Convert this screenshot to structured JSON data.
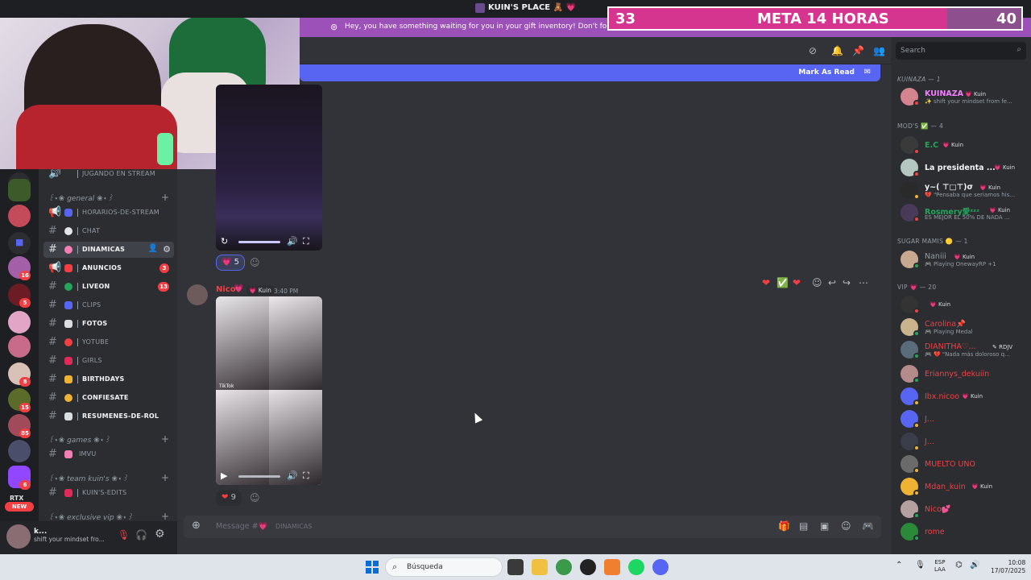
{
  "window": {
    "title": "KUIN'S PLACE 🧸 💗"
  },
  "notice": {
    "text": "Hey, you have something waiting for you in your gift inventory! Don't forget to clai"
  },
  "overlay": {
    "left_value": "33",
    "label": "META 14 HORAS",
    "right_value": "40"
  },
  "server_rail": {
    "badges": [
      "16",
      "5",
      "8",
      "15",
      "85",
      "6"
    ],
    "rtx_label": "RTX",
    "new_label": "NEW"
  },
  "channels": {
    "top_partial": "JUGANDO EN STREAM",
    "categories": [
      {
        "label": "꒰⋆❀ general ❀⋆꒱"
      },
      {
        "label": "꒰⋆❀ games ❀⋆꒱"
      },
      {
        "label": "꒰⋆❀ team kuin's ❀⋆꒱"
      },
      {
        "label": "꒰⋆❀ exclusive vip ❀⋆꒱"
      }
    ],
    "items": [
      {
        "name": "horarios-de-stream"
      },
      {
        "name": "chat"
      },
      {
        "name": "dinamicas"
      },
      {
        "name": "anuncios",
        "badge": "3"
      },
      {
        "name": "liveon",
        "badge": "13"
      },
      {
        "name": "clips"
      },
      {
        "name": "fotos"
      },
      {
        "name": "yotube"
      },
      {
        "name": "girls"
      },
      {
        "name": "birthdays"
      },
      {
        "name": "confiesate"
      },
      {
        "name": "resumenes-de-rol"
      },
      {
        "name": "imvu"
      },
      {
        "name": "kuin's-edits"
      }
    ]
  },
  "user_panel": {
    "name": "k...",
    "status": "shift your mindset fro..."
  },
  "header": {
    "mark_read": "Mark As Read"
  },
  "messages": {
    "first_reaction_count": "5",
    "author": "Nico",
    "author_tag": "Kuin",
    "timestamp": "3:40 PM",
    "second_reaction_count": "9",
    "tiktok_label": "TikTok"
  },
  "composer": {
    "placeholder": "Message #💗",
    "channel": "dinamicas"
  },
  "members": {
    "search_placeholder": "Search",
    "groups": [
      {
        "label": "KUINAZA — 1"
      },
      {
        "label": "MOD'S ✅ — 4"
      },
      {
        "label": "SUGAR MAMIS 🟡 — 1"
      },
      {
        "label": "VIP 💗 — 20"
      }
    ],
    "list": [
      {
        "name": "KUINAZA",
        "tag": "Kuin",
        "sub": "✨ shift your mindset from fe...",
        "color": "#f47fff"
      },
      {
        "name": "E.C",
        "tag": "Kuin",
        "sub": "",
        "color": "#23a55a"
      },
      {
        "name": "La presidenta ...",
        "tag": "Kuin",
        "sub": "",
        "color": "#f2f3f5"
      },
      {
        "name": "y~( ⊤□⊤)σ",
        "tag": "Kuin",
        "sub": "💔 \"Pensaba que seriamos his...",
        "color": "#f2f3f5"
      },
      {
        "name": "Rosmery愛ᶻᶻᶻ",
        "tag": "Kuin",
        "sub": "ES MEJOR EL 50% DE NADA ...",
        "color": "#23a55a"
      },
      {
        "name": "Naniii",
        "tag": "Kuin",
        "sub": "🎮 Playing OnewayRP +1",
        "color": "#949ba4"
      },
      {
        "name": "",
        "tag": "Kuin",
        "sub": "",
        "color": "#f2f3f5"
      },
      {
        "name": "Carolina📌",
        "tag": "",
        "sub": "🎮 Playing Medal",
        "color": "#f23f43"
      },
      {
        "name": "DIANITHA♡...",
        "tag": "RDJV",
        "sub": "🎮 💔 \"Nada más doloroso q...",
        "color": "#f23f43"
      },
      {
        "name": "Eriannys_dekuiin",
        "tag": "",
        "sub": "",
        "color": "#f23f43"
      },
      {
        "name": "Ibx.nicoo",
        "tag": "Kuin",
        "sub": "",
        "color": "#f23f43"
      },
      {
        "name": "J...",
        "tag": "",
        "sub": "",
        "color": "#f23f43"
      },
      {
        "name": "J...",
        "tag": "",
        "sub": "",
        "color": "#f23f43"
      },
      {
        "name": "MUELTO UNO",
        "tag": "",
        "sub": "",
        "color": "#f23f43"
      },
      {
        "name": "Mdan_kuin",
        "tag": "Kuin",
        "sub": "",
        "color": "#f23f43"
      },
      {
        "name": "Nico💕",
        "tag": "",
        "sub": "",
        "color": "#f23f43"
      },
      {
        "name": "rome",
        "tag": "",
        "sub": "",
        "color": "#f23f43"
      }
    ]
  },
  "taskbar": {
    "search_placeholder": "Búsqueda",
    "lang_top": "ESP",
    "lang_bottom": "LAA",
    "time": "10:08",
    "date": "17/07/2025"
  }
}
